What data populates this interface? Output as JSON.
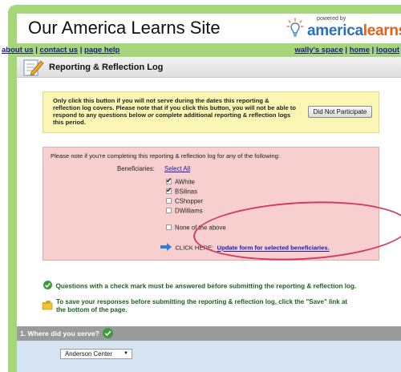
{
  "header": {
    "site_title": "Our America Learns Site",
    "logo_powered_by": "powered by",
    "logo_brand_part1": "america",
    "logo_brand_part2": "learns"
  },
  "nav": {
    "left_links": [
      "about us",
      "contact us",
      "page help"
    ],
    "right_links": [
      "wally's space",
      "home",
      "logout"
    ],
    "separator": "|"
  },
  "log": {
    "title": "Reporting & Reflection Log"
  },
  "notice": {
    "text_part1": "Only click this button if you will not serve during the dates this reporting & reflection log covers. Please note that if you click this button, you will not be able to respond to any questions below ",
    "text_or": "or",
    "text_part2": " complete additional reporting & reflection logs this period.",
    "button_label": "Did Not Participate"
  },
  "beneficiaries": {
    "note": "Please note if you're completing this reporting & reflection log for any of the following:",
    "label": "Beneficiaries:",
    "select_all": "Select All",
    "options": [
      {
        "name": "AWhite",
        "checked": true
      },
      {
        "name": "BSilinas",
        "checked": true
      },
      {
        "name": "CShopper",
        "checked": false
      },
      {
        "name": "DWilliams",
        "checked": false
      }
    ],
    "none_option": "None of the above",
    "click_here": "CLICK HERE:",
    "update_link": "Update form for selected beneficiaries."
  },
  "info": {
    "required_note": "Questions with a check mark must be answered before submitting the reporting & reflection log.",
    "save_note_line1": "To save your responses before submitting the reporting & reflection log, click the \"Save\" link at",
    "save_note_line2": "the bottom of the page."
  },
  "question1": {
    "title": "1. Where did you serve?",
    "selected_value": "Anderson Center"
  },
  "colors": {
    "frame_green": "#a6d57a",
    "notice_yellow": "#fbf6b4",
    "beneficiary_pink": "#f8cfcf",
    "highlight_circle": "#d23a5e",
    "question_header_gray": "#9a9a9a",
    "question_body_blue": "#d5e3f3"
  },
  "icons": {
    "logo": "lightbulb-icon",
    "log": "edit-log-icon",
    "click_here": "arrow-right-icon",
    "required": "green-check-icon",
    "save": "folder-icon"
  }
}
